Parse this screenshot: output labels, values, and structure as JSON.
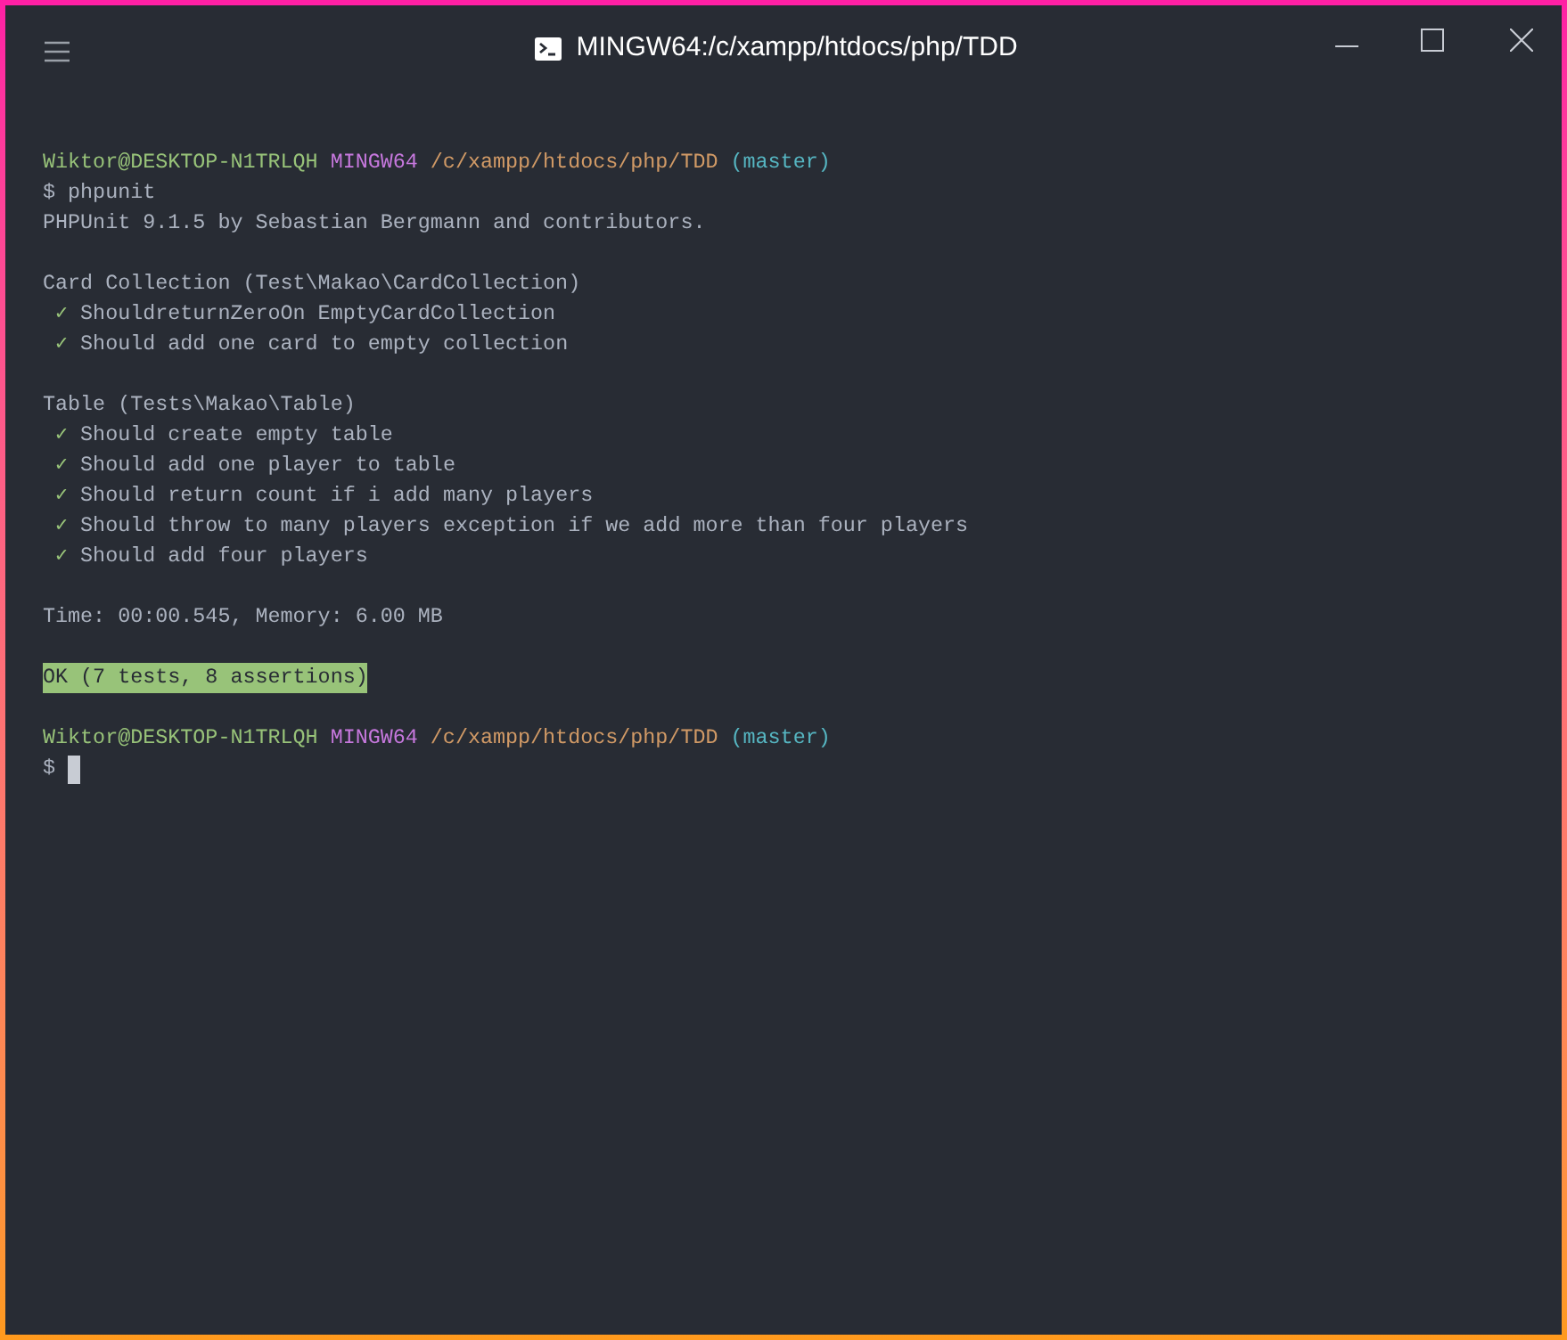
{
  "window": {
    "title": "MINGW64:/c/xampp/htdocs/php/TDD"
  },
  "lines": [
    {
      "kind": "prompt",
      "user": "Wiktor@DESKTOP-N1TRLQH",
      "shell": "MINGW64",
      "path": "/c/xampp/htdocs/php/TDD",
      "branch": "(master)"
    },
    {
      "kind": "text",
      "text": "$ phpunit"
    },
    {
      "kind": "text",
      "text": "PHPUnit 9.1.5 by Sebastian Bergmann and contributors."
    },
    {
      "kind": "blank"
    },
    {
      "kind": "text",
      "text": "Card Collection (Test\\Makao\\CardCollection)"
    },
    {
      "kind": "test",
      "mark": "✓",
      "text": "ShouldreturnZeroOn EmptyCardCollection"
    },
    {
      "kind": "test",
      "mark": "✓",
      "text": "Should add one card to empty collection"
    },
    {
      "kind": "blank"
    },
    {
      "kind": "text",
      "text": "Table (Tests\\Makao\\Table)"
    },
    {
      "kind": "test",
      "mark": "✓",
      "text": "Should create empty table"
    },
    {
      "kind": "test",
      "mark": "✓",
      "text": "Should add one player to table"
    },
    {
      "kind": "test",
      "mark": "✓",
      "text": "Should return count if i add many players"
    },
    {
      "kind": "test",
      "mark": "✓",
      "text": "Should throw to many players exception if we add more than four players"
    },
    {
      "kind": "test",
      "mark": "✓",
      "text": "Should add four players"
    },
    {
      "kind": "blank"
    },
    {
      "kind": "text",
      "text": "Time: 00:00.545, Memory: 6.00 MB"
    },
    {
      "kind": "blank"
    },
    {
      "kind": "ok",
      "text": "OK (7 tests, 8 assertions)"
    },
    {
      "kind": "blank"
    },
    {
      "kind": "prompt",
      "user": "Wiktor@DESKTOP-N1TRLQH",
      "shell": "MINGW64",
      "path": "/c/xampp/htdocs/php/TDD",
      "branch": "(master)"
    },
    {
      "kind": "cursor",
      "text": "$"
    }
  ]
}
